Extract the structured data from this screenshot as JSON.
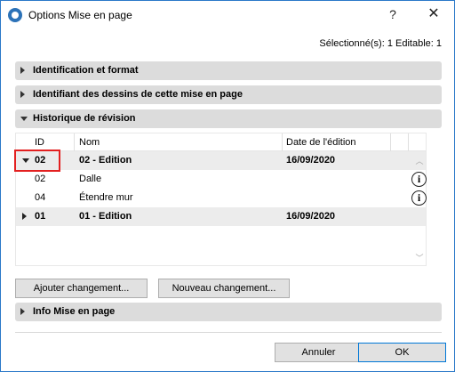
{
  "window": {
    "title": "Options Mise en page",
    "help_label": "?",
    "close_label": "✕"
  },
  "selection_info": "Sélectionné(s): 1 Editable: 1",
  "sections": {
    "identification": "Identification et format",
    "drawing_ids": "Identifiant des dessins de cette mise en page",
    "revision_history": "Historique de révision",
    "layout_info": "Info Mise en page"
  },
  "revision_table": {
    "columns": [
      "ID",
      "Nom",
      "Date de l'édition"
    ],
    "rows": [
      {
        "id": "02",
        "name": "02 - Edition",
        "date": "16/09/2020",
        "expanded": true,
        "bold": true
      },
      {
        "id": "02",
        "name": "Dalle",
        "date": "",
        "child": true,
        "info_icon": true
      },
      {
        "id": "04",
        "name": "Étendre mur",
        "date": "",
        "child": true,
        "info_icon": true
      },
      {
        "id": "01",
        "name": "01 - Edition",
        "date": "16/09/2020",
        "expanded": false,
        "bold": true
      }
    ]
  },
  "buttons": {
    "add_change": "Ajouter changement...",
    "new_change": "Nouveau changement...",
    "cancel": "Annuler",
    "ok": "OK"
  },
  "icons": {
    "info": "i"
  }
}
